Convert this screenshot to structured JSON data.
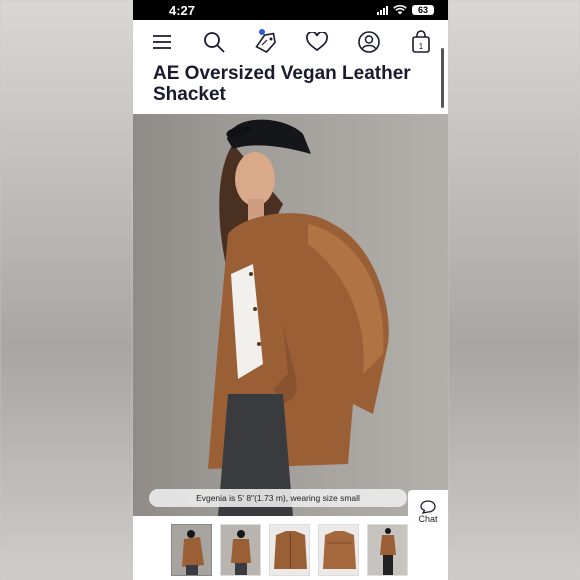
{
  "status_bar": {
    "time": "4:27",
    "battery": "63"
  },
  "nav": {
    "icons": [
      "menu-icon",
      "search-icon",
      "price-tag-icon",
      "heart-icon",
      "account-icon",
      "shopping-bag-icon"
    ],
    "cart_count": "1"
  },
  "product": {
    "title": "AE Oversized Vegan Leather Shacket"
  },
  "image": {
    "caption": "Evgenia is 5' 8\"(1.73 m), wearing size small"
  },
  "chat": {
    "label": "Chat"
  },
  "colors": {
    "jacket": "#9a5f35",
    "cap": "#15161a",
    "jeans": "#3a3b3f",
    "navy": "#1a1a2e",
    "accent_dot": "#2c5bd6"
  },
  "thumbnails": [
    {
      "alt": "model-front",
      "selected": true
    },
    {
      "alt": "model-back",
      "selected": false
    },
    {
      "alt": "jacket-flat-front",
      "selected": false
    },
    {
      "alt": "jacket-flat-back",
      "selected": false
    },
    {
      "alt": "model-full",
      "selected": false
    }
  ]
}
